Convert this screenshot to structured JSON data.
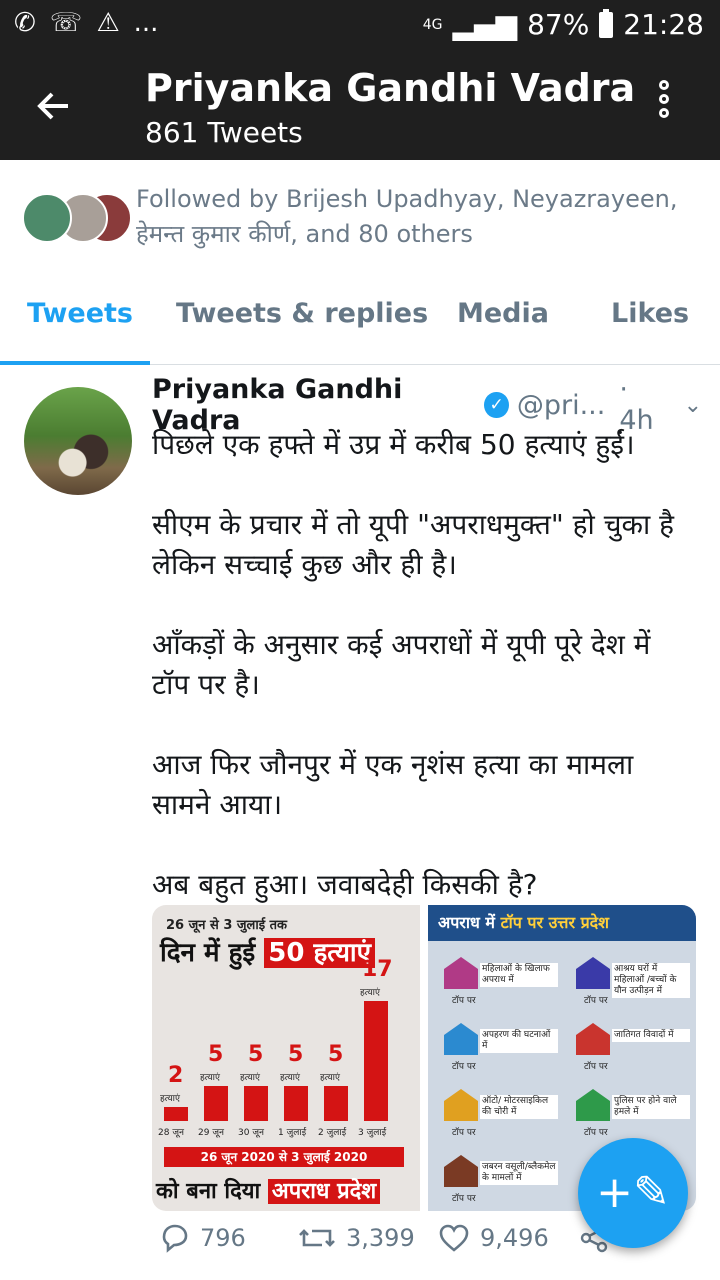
{
  "status_bar": {
    "left_icons": [
      "whatsapp-icon",
      "missed-call-icon",
      "warning-icon"
    ],
    "ellipsis": "...",
    "network": "4G",
    "battery": "87%",
    "time": "21:28"
  },
  "header": {
    "title": "Priyanka Gandhi Vadra",
    "subtitle": "861 Tweets",
    "back_icon": "arrow-left-icon",
    "menu_icon": "more-vert-icon"
  },
  "followed_by": {
    "text": "Followed by Brijesh Upadhyay, Neyazrayeen, हेमन्त कुमार कीर्ण, and 80 others"
  },
  "tabs": [
    {
      "label": "Tweets",
      "active": true
    },
    {
      "label": "Tweets & replies",
      "active": false
    },
    {
      "label": "Media",
      "active": false
    },
    {
      "label": "Likes",
      "active": false
    }
  ],
  "tweet": {
    "name": "Priyanka Gandhi Vadra",
    "handle": "@pri...",
    "time": "· 4h",
    "lines": [
      "पिछले एक हफ्ते में उप्र में करीब 50 हत्याएं हुईं।",
      "सीएम के प्रचार में तो यूपी \"अपराधमुक्त\" हो चुका है लेकिन सच्चाई कुछ और ही है।",
      "आँकड़ों के अनुसार कई अपराधों में यूपी पूरे देश में टॉप पर है।",
      "आज फिर जौनपुर में एक नृशंस हत्या का मामला सामने आया।",
      "अब बहुत हुआ। जवाबदेही किसकी है?"
    ],
    "image1": {
      "tag": "26 जून से 3 जुलाई तक",
      "headline_a": "दिन में हुई",
      "headline_b": "50 हत्याएं",
      "bar_unit": "हत्याएं",
      "dates": [
        "28 जून",
        "29 जून",
        "30 जून",
        "1 जुलाई",
        "2 जुलाई",
        "3 जुलाई"
      ],
      "values": [
        2,
        5,
        5,
        5,
        5,
        17
      ],
      "range": "26 जून 2020 से 3 जुलाई 2020",
      "foot_a": "को बना दिया",
      "foot_b": "अपराध प्रदेश"
    },
    "image2": {
      "headline_a": "अपराध में",
      "headline_b": "टॉप पर उत्तर प्रदेश",
      "items": [
        {
          "text": "महिलाओं के खिलाफ अपराध में",
          "color": "#b03a86"
        },
        {
          "text": "आश्रय घरों में महिलाओं /बच्चों के यौन उत्पीड़न में",
          "color": "#3a3aa8"
        },
        {
          "text": "अपहरण की घटनाओं में",
          "color": "#2b8ad0"
        },
        {
          "text": "जातिगत विवादों में",
          "color": "#c9342e"
        },
        {
          "text": "ऑटो/ मोटरसाइकिल की चोरी में",
          "color": "#e0a020"
        },
        {
          "text": "पुलिस पर होने वाले हमले में",
          "color": "#2e9a4a"
        },
        {
          "text": "जबरन वसूली/ब्लैकमेल के मामलों में",
          "color": "#7a3a24"
        }
      ],
      "top_label": "टॉप पर"
    },
    "replies": "796",
    "retweets": "3,399",
    "likes": "9,496"
  },
  "fab_icon": "compose-tweet-icon"
}
